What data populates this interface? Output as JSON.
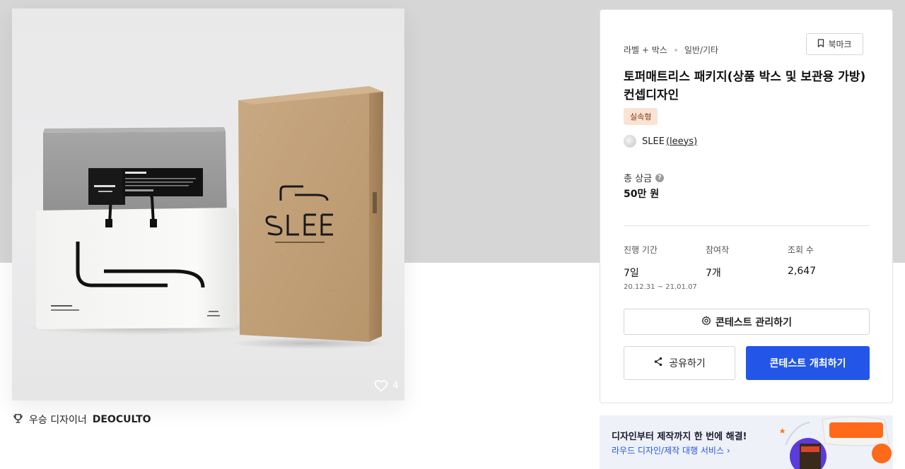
{
  "product": {
    "likes": "4"
  },
  "award": {
    "label": "우승 디자이너",
    "designer": "DEOCULTO"
  },
  "contest": {
    "category": "라벨 + 박스",
    "subcategory": "일반/기타",
    "bookmark_label": "북마크",
    "title": "토퍼매트리스 패키지(상품 박스 및 보관용 가방) 컨셉디자인",
    "tag": "실속형",
    "host_name": "SLEE",
    "host_handle": "(leeys)",
    "prize_label": "총 상금",
    "prize_value": "50만 원",
    "stats": [
      {
        "label": "진행 기간",
        "value": "7일",
        "sub": "20.12.31 ~ 21.01.07"
      },
      {
        "label": "참여작",
        "value": "7개",
        "sub": ""
      },
      {
        "label": "조회 수",
        "value": "2,647",
        "sub": ""
      }
    ],
    "manage_label": "콘테스트 관리하기",
    "share_label": "공유하기",
    "host_contest_label": "콘테스트 개최하기"
  },
  "ad": {
    "title": "디자인부터 제작까지 한 번에 해결!",
    "link": "라우드 디자인/제작 대행 서비스 ›"
  },
  "colors": {
    "primary": "#2356e8",
    "tag_bg": "#fbe3d3",
    "page_gray": "#d6d6d6"
  }
}
